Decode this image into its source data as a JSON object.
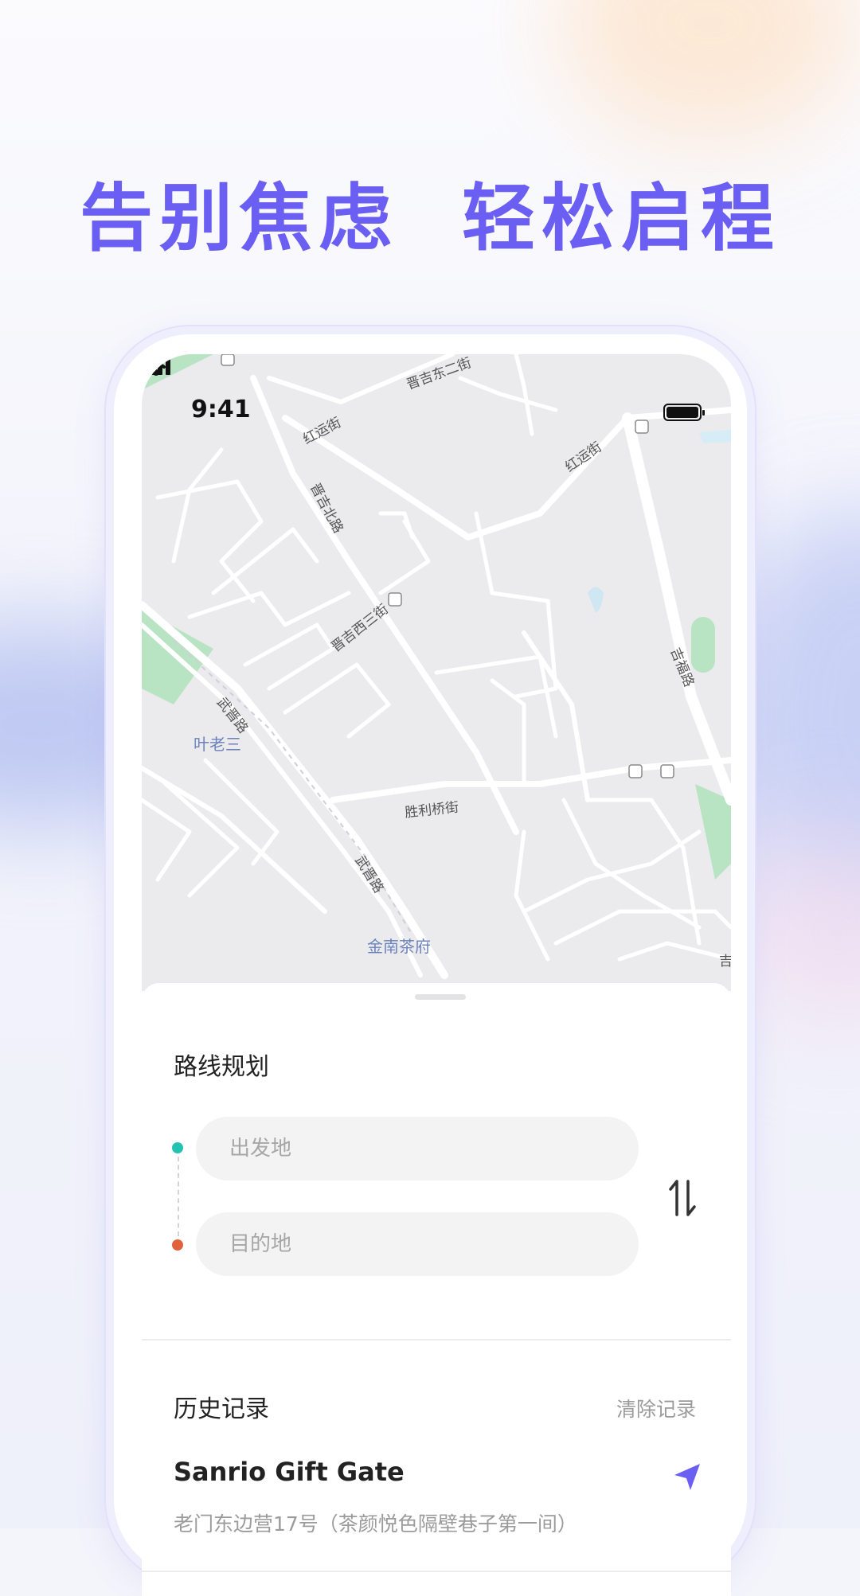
{
  "headline": "告别焦虑  轻松启程",
  "status_bar": {
    "time": "9:41"
  },
  "map": {
    "street_labels": [
      "晋吉东二街",
      "红运街",
      "红运街",
      "晋吉北路",
      "晋吉西三街",
      "吉福路",
      "武晋路",
      "武晋路",
      "胜利桥街",
      "吉"
    ],
    "pois": [
      "叶老三",
      "金南茶府"
    ]
  },
  "route": {
    "title": "路线规划",
    "origin_placeholder": "出发地",
    "destination_placeholder": "目的地",
    "swap_icon": "swap-icon"
  },
  "history": {
    "title": "历史记录",
    "clear_label": "清除记录",
    "items": [
      {
        "name": "Sanrio Gift Gate",
        "address": "老门东边营17号（茶颜悦色隔壁巷子第一间）"
      }
    ]
  },
  "colors": {
    "accent": "#6a5ef3",
    "start": "#22c3b0",
    "end": "#e0623d"
  }
}
